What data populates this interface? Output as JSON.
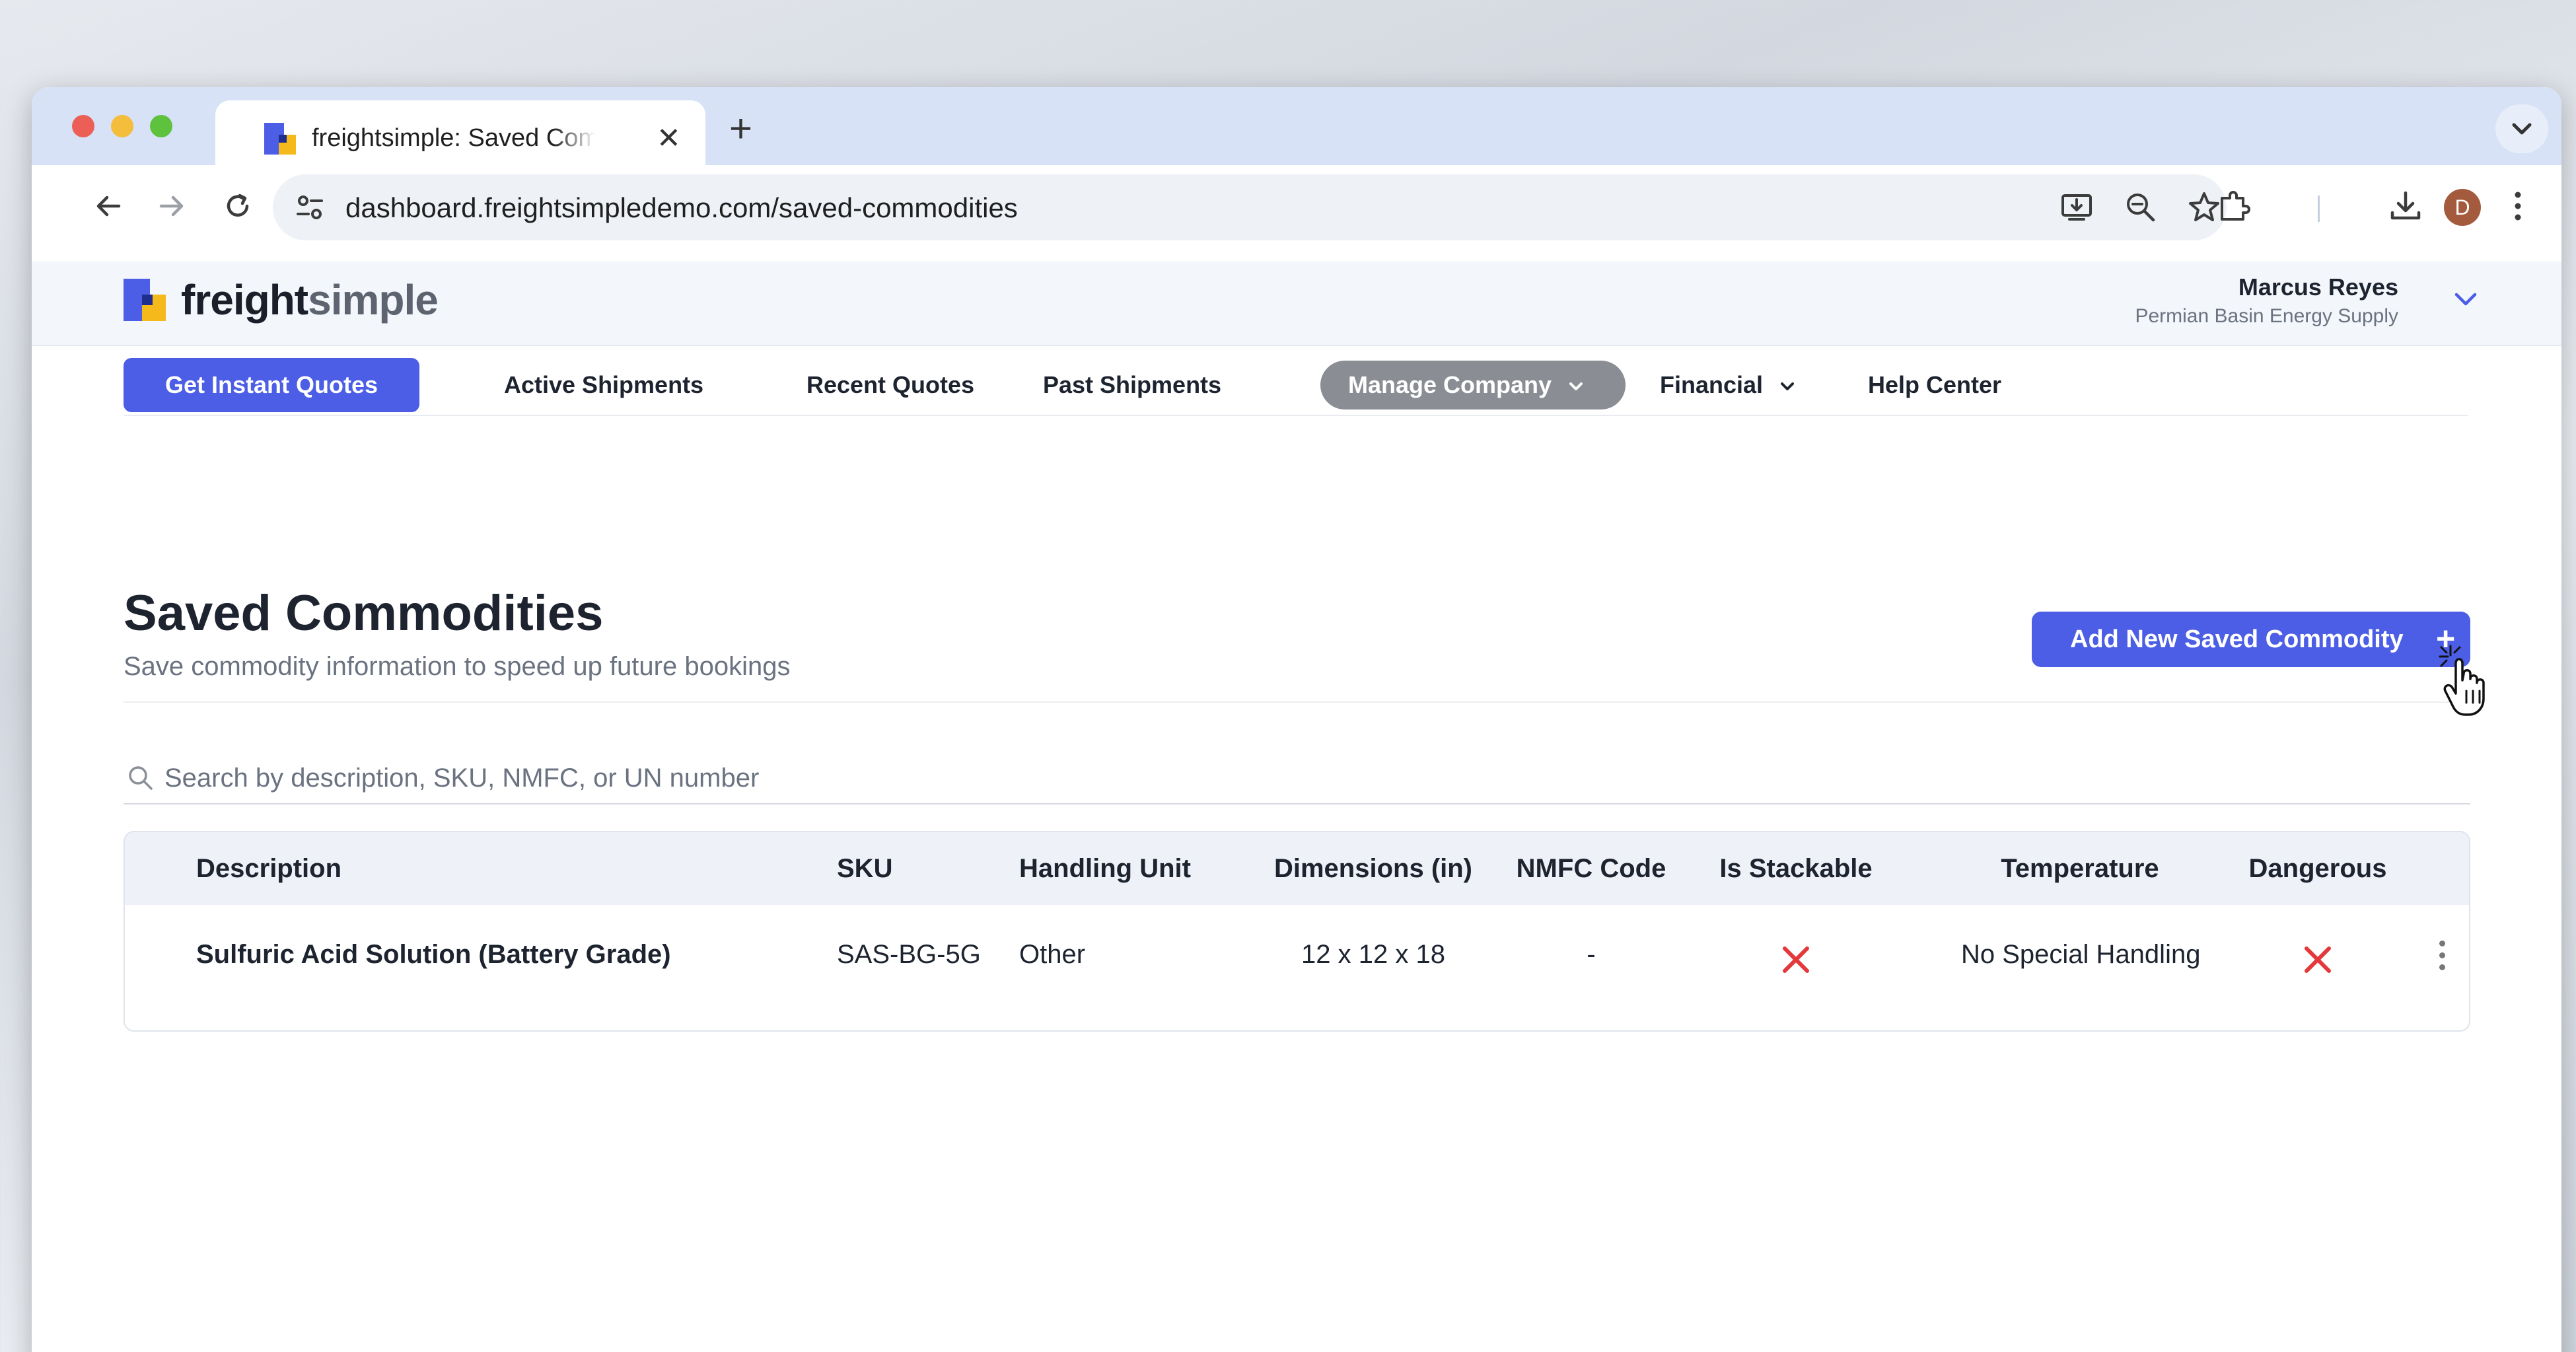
{
  "browser": {
    "tab_title": "freightsimple: Saved Commodities",
    "url": "dashboard.freightsimpledemo.com/saved-commodities",
    "profile_initial": "D"
  },
  "app": {
    "logo_part1": "freight",
    "logo_part2": "simple",
    "user": {
      "name": "Marcus Reyes",
      "company": "Permian Basin Energy Supply"
    },
    "nav": {
      "primary": "Get Instant Quotes",
      "items": [
        "Active Shipments",
        "Recent Quotes",
        "Past Shipments"
      ],
      "active": "Manage Company",
      "financial": "Financial",
      "help": "Help Center"
    }
  },
  "page": {
    "title": "Saved Commodities",
    "subtitle": "Save commodity information to speed up future bookings",
    "add_button": "Add New Saved Commodity",
    "add_icon": "+",
    "search_placeholder": "Search by description, SKU, NMFC, or UN number"
  },
  "table": {
    "headers": [
      "Description",
      "SKU",
      "Handling Unit",
      "Dimensions (in)",
      "NMFC Code",
      "Is Stackable",
      "Temperature",
      "Dangerous"
    ],
    "rows": [
      {
        "description": "Sulfuric Acid Solution (Battery Grade)",
        "sku": "SAS-BG-5G",
        "handling_unit": "Other",
        "dimensions": "12 x 12 x 18",
        "nmfc": "-",
        "stackable": "x-icon",
        "temperature": "No Special Handling",
        "dangerous": "x-icon"
      }
    ]
  },
  "colors": {
    "brand": "#4b5ee5",
    "brand_yellow": "#f6b91c",
    "danger": "#e5383b",
    "active_pill": "#8a8d93"
  }
}
